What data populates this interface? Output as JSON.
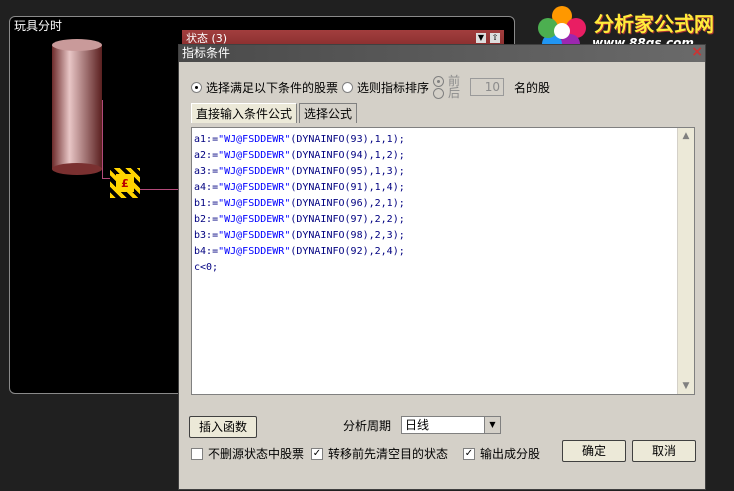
{
  "background": {
    "panel_title": "玩具分时",
    "node_glyph": "£",
    "status_title": "状态 (3)"
  },
  "logo": {
    "title": "分析家公式网",
    "url": "www.88gs.com"
  },
  "dialog": {
    "title": "指标条件",
    "close_glyph": "×",
    "mode": {
      "option_conditions": "选择满足以下条件的股票",
      "option_ranking": "选则指标排序",
      "order_front": "前",
      "order_back": "后",
      "count_value": "10",
      "count_suffix": "名的股",
      "selected": "conditions"
    },
    "tabs": [
      "直接输入条件公式",
      "选择公式"
    ],
    "formula_lines": [
      {
        "var": "a1",
        "s": "\"WJ@FSDDEWR\"",
        "arg": "(DYNAINFO(93),1,1);"
      },
      {
        "var": "a2",
        "s": "\"WJ@FSDDEWR\"",
        "arg": "(DYNAINFO(94),1,2);"
      },
      {
        "var": "a3",
        "s": "\"WJ@FSDDEWR\"",
        "arg": "(DYNAINFO(95),1,3);"
      },
      {
        "var": "a4",
        "s": "\"WJ@FSDDEWR\"",
        "arg": "(DYNAINFO(91),1,4);"
      },
      {
        "var": "b1",
        "s": "\"WJ@FSDDEWR\"",
        "arg": "(DYNAINFO(96),2,1);"
      },
      {
        "var": "b2",
        "s": "\"WJ@FSDDEWR\"",
        "arg": "(DYNAINFO(97),2,2);"
      },
      {
        "var": "b3",
        "s": "\"WJ@FSDDEWR\"",
        "arg": "(DYNAINFO(98),2,3);"
      },
      {
        "var": "b4",
        "s": "\"WJ@FSDDEWR\"",
        "arg": "(DYNAINFO(92),2,4);"
      }
    ],
    "formula_tail": "c<0;",
    "insert_function_label": "插入函数",
    "period_label": "分析周期",
    "period_value": "日线",
    "checkboxes": [
      {
        "label": "不删源状态中股票",
        "checked": false
      },
      {
        "label": "转移前先清空目的状态",
        "checked": true
      },
      {
        "label": "输出成分股",
        "checked": true
      }
    ],
    "ok_label": "确定",
    "cancel_label": "取消"
  }
}
